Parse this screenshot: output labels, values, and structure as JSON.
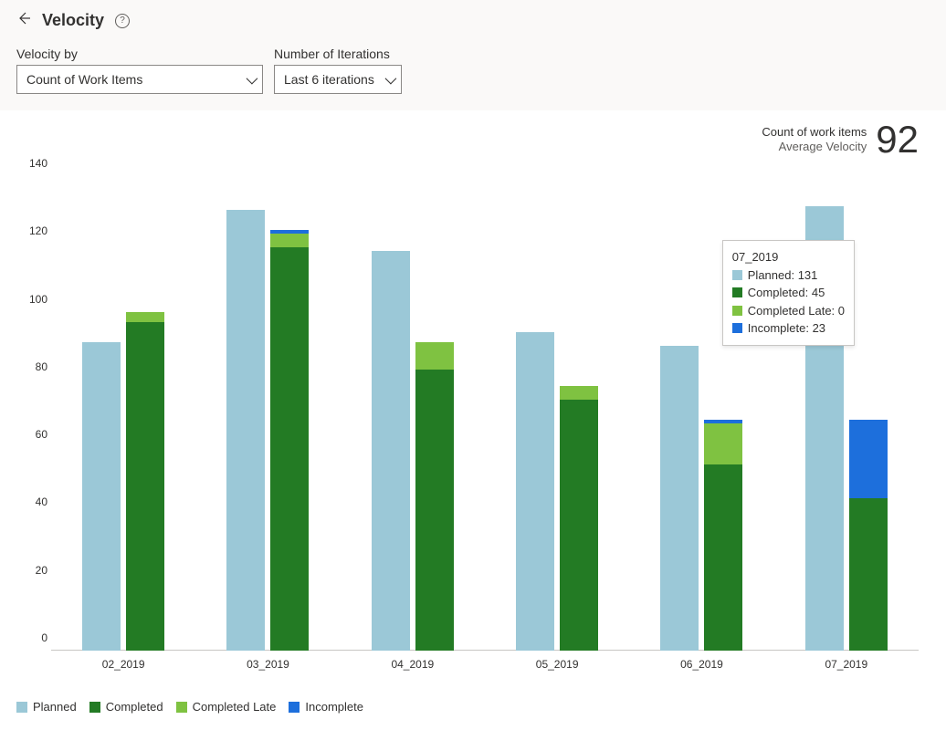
{
  "header": {
    "title": "Velocity"
  },
  "controls": {
    "velocity_by": {
      "label": "Velocity by",
      "value": "Count of Work Items"
    },
    "iterations": {
      "label": "Number of Iterations",
      "value": "Last 6 iterations"
    }
  },
  "summary": {
    "line1": "Count of work items",
    "line2": "Average Velocity",
    "value": "92"
  },
  "colors": {
    "planned": "#9bc8d7",
    "completed": "#237b24",
    "completed_late": "#7fc241",
    "incomplete": "#1d6fdc"
  },
  "legend": {
    "planned": "Planned",
    "completed": "Completed",
    "completed_late": "Completed Late",
    "incomplete": "Incomplete"
  },
  "tooltip": {
    "title": "07_2019",
    "rows": [
      {
        "sw": "planned",
        "text": "Planned: 131"
      },
      {
        "sw": "completed",
        "text": "Completed: 45"
      },
      {
        "sw": "completed_late",
        "text": "Completed Late: 0"
      },
      {
        "sw": "incomplete",
        "text": "Incomplete: 23"
      }
    ]
  },
  "chart_data": {
    "type": "bar",
    "ylabel": "",
    "xlabel": "",
    "ylim": [
      0,
      140
    ],
    "yticks": [
      0,
      20,
      40,
      60,
      80,
      100,
      120,
      140
    ],
    "categories": [
      "02_2019",
      "03_2019",
      "04_2019",
      "05_2019",
      "06_2019",
      "07_2019"
    ],
    "series": [
      {
        "name": "Planned",
        "stack": "a",
        "color": "planned",
        "values": [
          91,
          130,
          118,
          94,
          90,
          131
        ]
      },
      {
        "name": "Completed",
        "stack": "b",
        "color": "completed",
        "values": [
          97,
          119,
          83,
          74,
          55,
          45
        ]
      },
      {
        "name": "Completed Late",
        "stack": "b",
        "color": "completed_late",
        "values": [
          3,
          4,
          8,
          4,
          12,
          0
        ]
      },
      {
        "name": "Incomplete",
        "stack": "b",
        "color": "incomplete",
        "values": [
          0,
          1,
          0,
          0,
          1,
          23
        ]
      }
    ]
  }
}
